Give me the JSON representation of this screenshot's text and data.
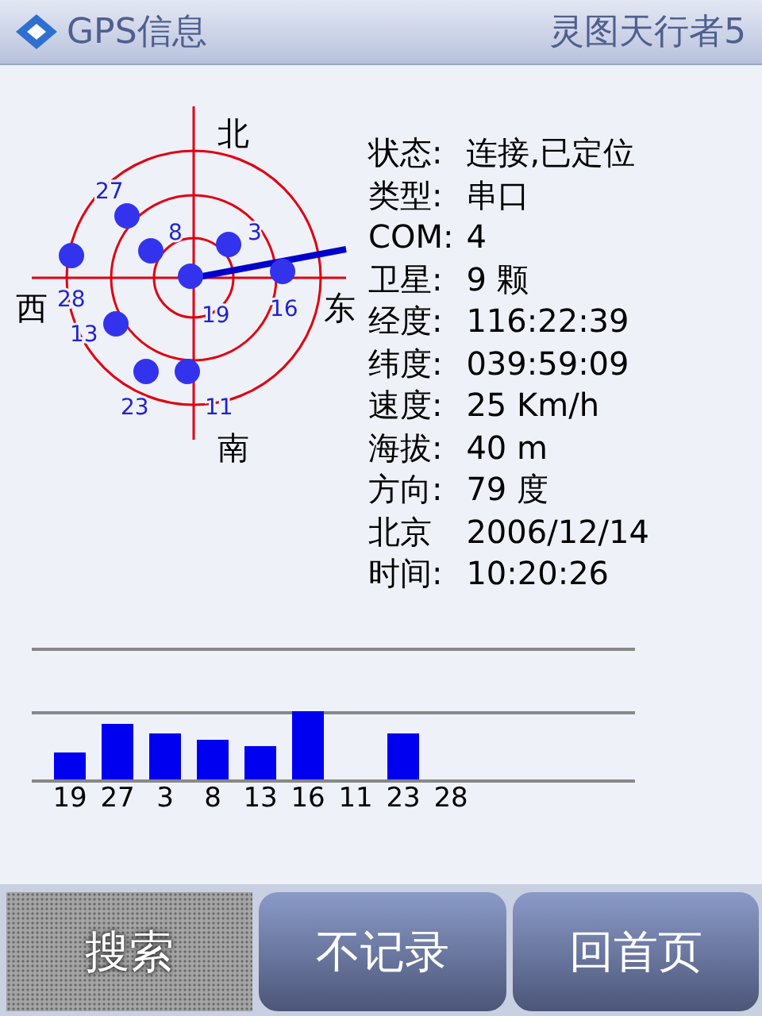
{
  "header": {
    "title": "GPS信息",
    "device": "灵图天行者5"
  },
  "sky_plot": {
    "directions": [
      "北",
      "南",
      "西",
      "东"
    ],
    "satellites": [
      {
        "label": "28"
      },
      {
        "label": "8"
      },
      {
        "label": "27"
      },
      {
        "label": "3"
      },
      {
        "label": "19"
      },
      {
        "label": "16"
      },
      {
        "label": "13"
      },
      {
        "label": "23"
      },
      {
        "label": "11"
      }
    ]
  },
  "info": [
    {
      "label": "状态:",
      "value": "连接,已定位"
    },
    {
      "label": "类型:",
      "value": "串口"
    },
    {
      "label": "COM:",
      "value": "4"
    },
    {
      "label": "卫星:",
      "value": "9 颗"
    },
    {
      "label": "经度:",
      "value": "116:22:39"
    },
    {
      "label": "纬度:",
      "value": "039:59:09"
    },
    {
      "label": "速度:",
      "value": "25 Km/h"
    },
    {
      "label": "海拔:",
      "value": "40 m"
    },
    {
      "label": "方向:",
      "value": "79 度"
    },
    {
      "label": "北京",
      "value": "2006/12/14"
    },
    {
      "label": "时间:",
      "value": "10:20:26"
    }
  ],
  "signal_bars": [
    {
      "label": "19"
    },
    {
      "label": "27"
    },
    {
      "label": "3"
    },
    {
      "label": "8"
    },
    {
      "label": "13"
    },
    {
      "label": "16"
    },
    {
      "label": "11"
    },
    {
      "label": "23"
    },
    {
      "label": "28"
    }
  ],
  "buttons": [
    {
      "label": "搜索",
      "selected": true
    },
    {
      "label": "不记录",
      "selected": false
    },
    {
      "label": "回首页",
      "selected": false
    }
  ]
}
